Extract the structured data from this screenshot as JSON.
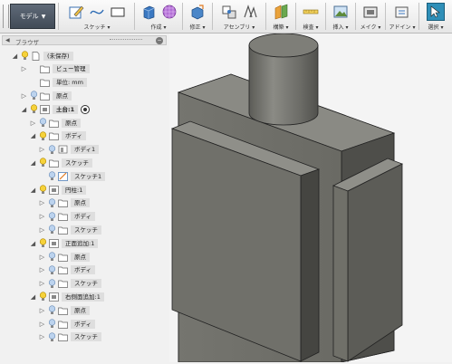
{
  "toolbar": {
    "mode_label": "モデル",
    "groups": [
      {
        "label": "スケッチ ▾"
      },
      {
        "label": "作成 ▾"
      },
      {
        "label": "修正 ▾"
      },
      {
        "label": "アセンブリ ▾"
      },
      {
        "label": "構築 ▾"
      },
      {
        "label": "検査 ▾"
      },
      {
        "label": "挿入 ▾"
      },
      {
        "label": "メイク ▾"
      },
      {
        "label": "アドイン ▾"
      },
      {
        "label": "選択 ▾"
      }
    ]
  },
  "browser": {
    "title": "ブラウザ",
    "nodes": [
      {
        "label": "(未保存)"
      },
      {
        "label": "ビュー管理"
      },
      {
        "label": "単位: mm"
      },
      {
        "label": "原点"
      },
      {
        "label": "土台:1"
      },
      {
        "label": "原点"
      },
      {
        "label": "ボディ"
      },
      {
        "label": "ボディ1"
      },
      {
        "label": "スケッチ"
      },
      {
        "label": "スケッチ1"
      },
      {
        "label": "円柱:1"
      },
      {
        "label": "原点"
      },
      {
        "label": "ボディ"
      },
      {
        "label": "スケッチ"
      },
      {
        "label": "正面追加:1"
      },
      {
        "label": "原点"
      },
      {
        "label": "ボディ"
      },
      {
        "label": "スケッチ"
      },
      {
        "label": "右側面追加:1"
      },
      {
        "label": "原点"
      },
      {
        "label": "ボディ"
      },
      {
        "label": "スケッチ"
      }
    ]
  },
  "colors": {
    "model_front": "#75756f",
    "model_side": "#5f5f5a",
    "model_top": "#8a8a84",
    "edge": "#222222"
  },
  "icons": [
    "model-mode-icon",
    "sketch-icon",
    "line-icon",
    "rectangle-icon",
    "extrude-icon",
    "sphere-grid-icon",
    "press-pull-icon",
    "joint-icon",
    "as-built-icon",
    "offset-plane-icon",
    "measure-icon",
    "insert-image-icon",
    "3d-print-icon",
    "addins-icon",
    "select-icon",
    "lightbulb-icon",
    "folder-icon",
    "component-icon",
    "body-icon",
    "sketch-node-icon"
  ]
}
